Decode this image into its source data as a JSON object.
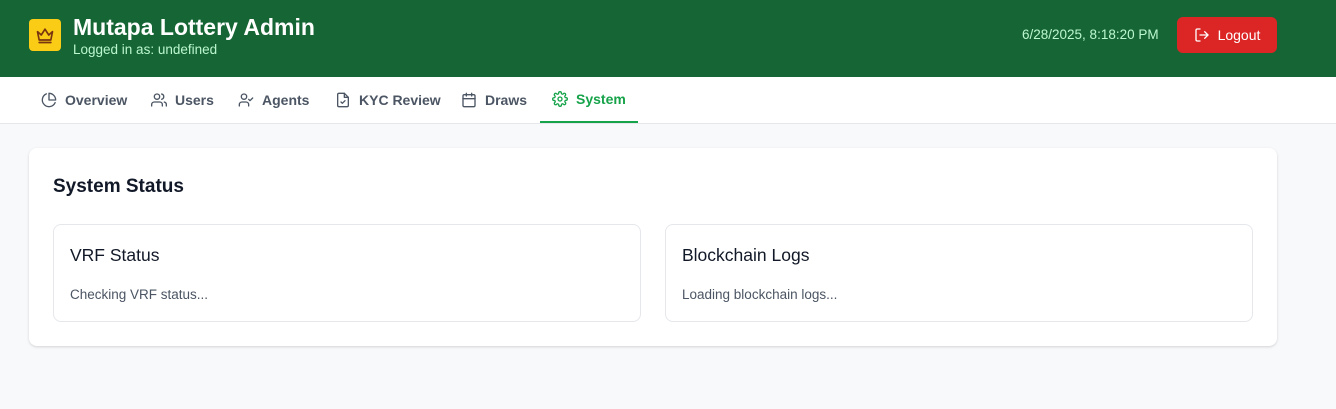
{
  "header": {
    "title": "Mutapa Lottery Admin",
    "subtitle": "Logged in as: undefined",
    "datetime": "6/28/2025, 8:18:20 PM",
    "logout_label": "Logout",
    "logo_icon": "crown-icon",
    "colors": {
      "header_bg": "#166534",
      "logout_bg": "#dc2626",
      "logo_bg": "#facc15"
    }
  },
  "nav": {
    "tabs": [
      {
        "label": "Overview",
        "icon": "pie-chart-icon"
      },
      {
        "label": "Users",
        "icon": "users-icon"
      },
      {
        "label": "Agents",
        "icon": "user-check-icon"
      },
      {
        "label": "KYC Review",
        "icon": "file-check-icon"
      },
      {
        "label": "Draws",
        "icon": "calendar-icon"
      },
      {
        "label": "System",
        "icon": "gear-icon",
        "active": true
      }
    ],
    "active_color": "#16a34a"
  },
  "main": {
    "title": "System Status",
    "panels": [
      {
        "title": "VRF Status",
        "text": "Checking VRF status..."
      },
      {
        "title": "Blockchain Logs",
        "text": "Loading blockchain logs..."
      }
    ]
  }
}
